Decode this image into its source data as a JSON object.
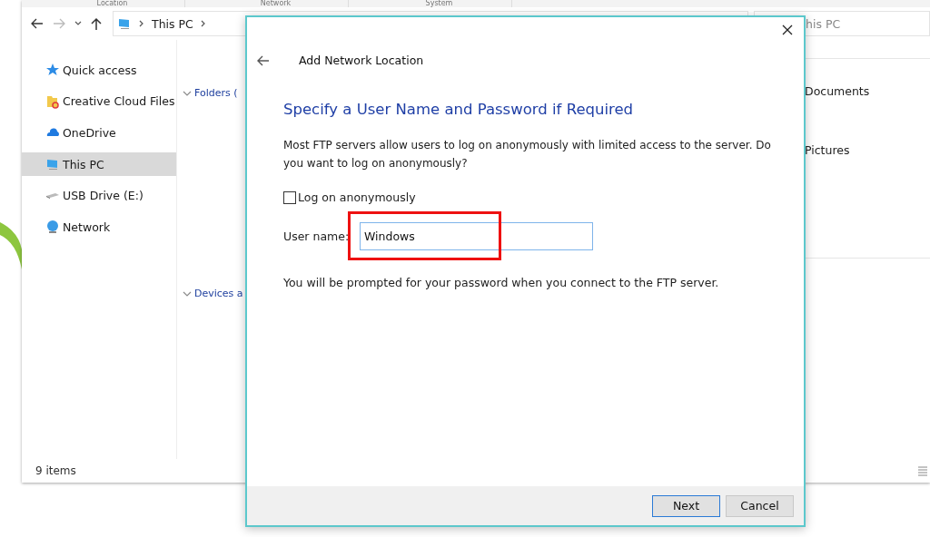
{
  "header_columns": [
    "Location",
    "Network",
    "System"
  ],
  "nav": {
    "address": "This PC",
    "search_placeholder": "his PC"
  },
  "sidebar": {
    "items": [
      {
        "label": "Quick access",
        "kind": "star",
        "selected": false
      },
      {
        "label": "Creative Cloud Files",
        "kind": "folder",
        "selected": false
      },
      {
        "label": "OneDrive",
        "kind": "cloud",
        "selected": false
      },
      {
        "label": "This PC",
        "kind": "pc",
        "selected": true
      },
      {
        "label": "USB Drive (E:)",
        "kind": "drive",
        "selected": false
      },
      {
        "label": "Network",
        "kind": "network",
        "selected": false
      }
    ]
  },
  "content": {
    "groups": [
      "Folders (",
      "Devices a"
    ],
    "items": [
      "Documents",
      "Pictures"
    ]
  },
  "status_bar": "9 items",
  "dialog": {
    "title": "Add Network Location",
    "heading": "Specify a User Name and Password if Required",
    "description": "Most FTP servers allow users to log on anonymously with limited access to the server.  Do you want to log on anonymously?",
    "anonymous": {
      "label": "Log on anonymously",
      "checked": false
    },
    "user_name": {
      "label": "User name:",
      "value": "Windows",
      "highlighted": true
    },
    "note": "You will be prompted for your password when you connect to the FTP server.",
    "buttons": [
      {
        "label": "Next",
        "default": true
      },
      {
        "label": "Cancel",
        "default": false
      }
    ]
  }
}
